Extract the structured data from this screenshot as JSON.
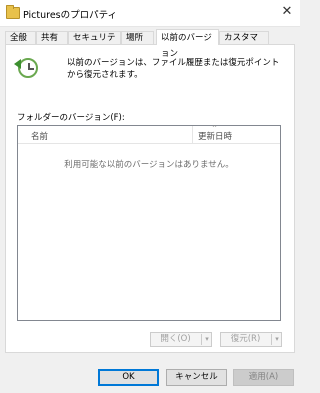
{
  "window": {
    "title": "Picturesのプロパティ",
    "close_glyph": "✕"
  },
  "tabs": [
    {
      "label": "全般"
    },
    {
      "label": "共有"
    },
    {
      "label": "セキュリティ"
    },
    {
      "label": "場所"
    },
    {
      "label": "以前のバージョン",
      "active": true
    },
    {
      "label": "カスタマイズ"
    }
  ],
  "restore_icon": "clock-restore-icon",
  "description": "以前のバージョンは、ファイル履歴または復元ポイントから復元されます。",
  "folder_versions": {
    "label": "フォルダーのバージョン(F):",
    "columns": {
      "name": "名前",
      "modified": "更新日時"
    },
    "empty_message": "利用可能な以前のバージョンはありません。"
  },
  "actions": {
    "open": {
      "label": "開く(O)",
      "dropdown_glyph": "▾",
      "enabled": false
    },
    "restore": {
      "label": "復元(R)",
      "dropdown_glyph": "▾",
      "enabled": false
    }
  },
  "dialog_buttons": {
    "ok": "OK",
    "cancel": "キャンセル",
    "apply": "適用(A)"
  },
  "colors": {
    "accent": "#0078d7",
    "panel_bg": "#ffffff",
    "window_bg": "#f0f0f0"
  }
}
